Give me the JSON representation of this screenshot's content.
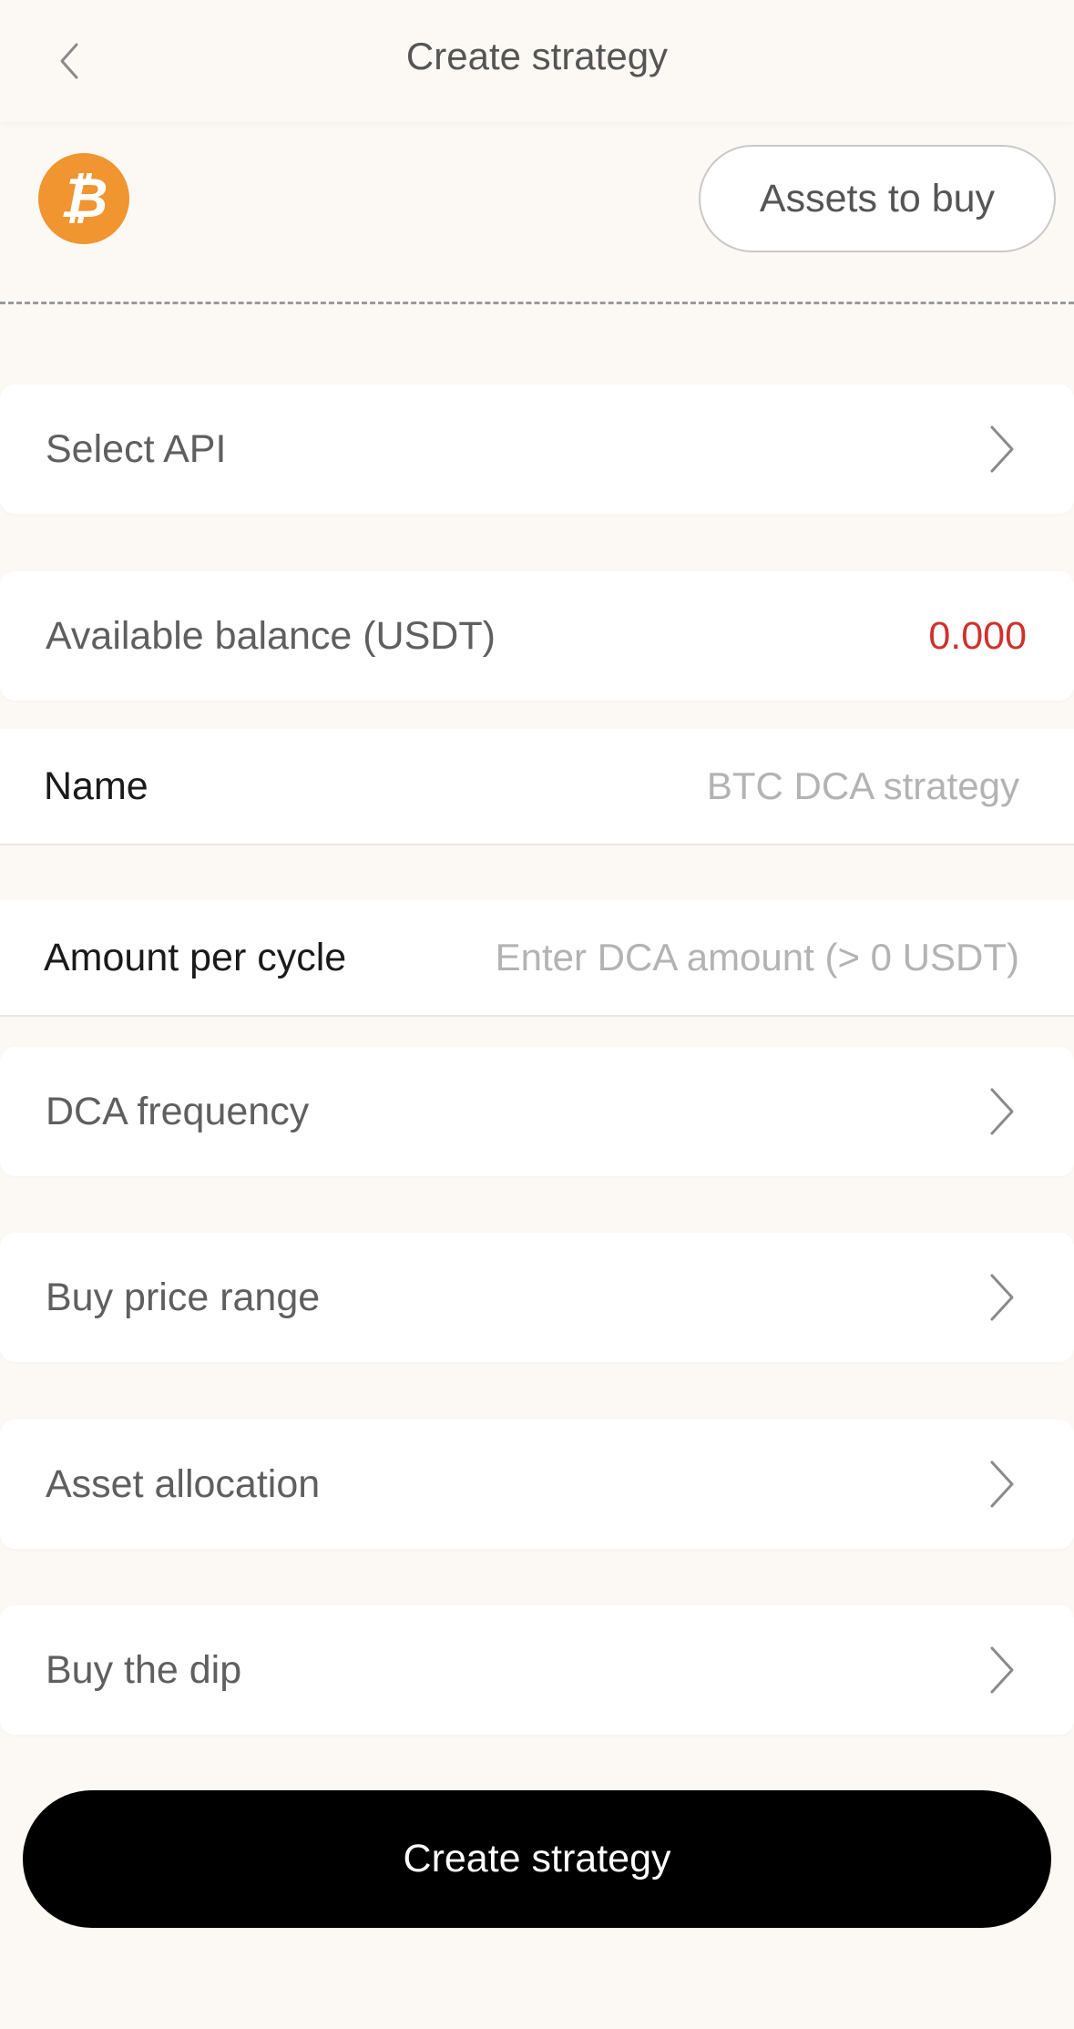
{
  "header": {
    "title": "Create strategy",
    "back_icon": "chevron-left-icon"
  },
  "asset": {
    "coin_icon": "bitcoin-icon",
    "coin_color": "#f0952f",
    "assets_button_label": "Assets to buy"
  },
  "form": {
    "select_api_label": "Select API",
    "balance_label": "Available balance (USDT)",
    "balance_value": "0.000",
    "balance_color": "#d0322b",
    "name_label": "Name",
    "name_placeholder": "BTC DCA strategy",
    "amount_label": "Amount per cycle",
    "amount_placeholder": "Enter DCA amount (> 0 USDT)",
    "frequency_label": "DCA frequency",
    "price_range_label": "Buy price range",
    "allocation_label": "Asset allocation",
    "dip_label": "Buy the dip"
  },
  "submit": {
    "label": "Create strategy"
  }
}
